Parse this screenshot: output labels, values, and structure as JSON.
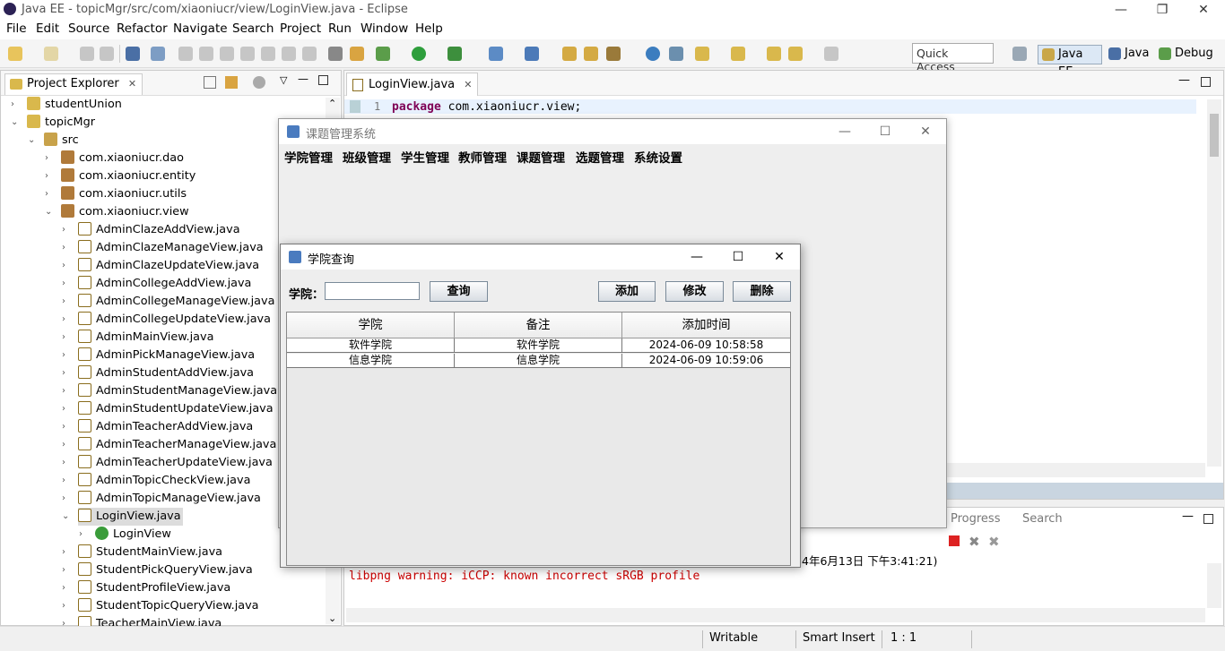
{
  "window": {
    "title": "Java EE - topicMgr/src/com/xiaoniucr/view/LoginView.java - Eclipse",
    "minimize": "—",
    "restore": "❐",
    "close": "✕"
  },
  "menu": [
    "File",
    "Edit",
    "Source",
    "Refactor",
    "Navigate",
    "Search",
    "Project",
    "Run",
    "Window",
    "Help"
  ],
  "toolbar": {
    "quick_access": "Quick Access",
    "perspectives": [
      "Java EE",
      "Java",
      "Debug"
    ]
  },
  "project_explorer": {
    "tab_label": "Project Explorer",
    "tab_close": "✕",
    "tree": [
      {
        "label": "studentUnion",
        "level": 1,
        "type": "proj",
        "arrow": "›"
      },
      {
        "label": "topicMgr",
        "level": 1,
        "type": "proj",
        "arrow": "⌄"
      },
      {
        "label": "src",
        "level": 2,
        "type": "src",
        "arrow": "⌄"
      },
      {
        "label": "com.xiaoniucr.dao",
        "level": 3,
        "type": "pkg",
        "arrow": "›"
      },
      {
        "label": "com.xiaoniucr.entity",
        "level": 3,
        "type": "pkg",
        "arrow": "›"
      },
      {
        "label": "com.xiaoniucr.utils",
        "level": 3,
        "type": "pkg",
        "arrow": "›"
      },
      {
        "label": "com.xiaoniucr.view",
        "level": 3,
        "type": "pkg",
        "arrow": "⌄"
      },
      {
        "label": "AdminClazeAddView.java",
        "level": 4,
        "type": "java",
        "arrow": "›"
      },
      {
        "label": "AdminClazeManageView.java",
        "level": 4,
        "type": "java",
        "arrow": "›"
      },
      {
        "label": "AdminClazeUpdateView.java",
        "level": 4,
        "type": "java",
        "arrow": "›"
      },
      {
        "label": "AdminCollegeAddView.java",
        "level": 4,
        "type": "java",
        "arrow": "›"
      },
      {
        "label": "AdminCollegeManageView.java",
        "level": 4,
        "type": "java",
        "arrow": "›"
      },
      {
        "label": "AdminCollegeUpdateView.java",
        "level": 4,
        "type": "java",
        "arrow": "›"
      },
      {
        "label": "AdminMainView.java",
        "level": 4,
        "type": "java",
        "arrow": "›"
      },
      {
        "label": "AdminPickManageView.java",
        "level": 4,
        "type": "java",
        "arrow": "›"
      },
      {
        "label": "AdminStudentAddView.java",
        "level": 4,
        "type": "java",
        "arrow": "›"
      },
      {
        "label": "AdminStudentManageView.java",
        "level": 4,
        "type": "java",
        "arrow": "›"
      },
      {
        "label": "AdminStudentUpdateView.java",
        "level": 4,
        "type": "java",
        "arrow": "›"
      },
      {
        "label": "AdminTeacherAddView.java",
        "level": 4,
        "type": "java",
        "arrow": "›"
      },
      {
        "label": "AdminTeacherManageView.java",
        "level": 4,
        "type": "java",
        "arrow": "›"
      },
      {
        "label": "AdminTeacherUpdateView.java",
        "level": 4,
        "type": "java",
        "arrow": "›"
      },
      {
        "label": "AdminTopicCheckView.java",
        "level": 4,
        "type": "java",
        "arrow": "›"
      },
      {
        "label": "AdminTopicManageView.java",
        "level": 4,
        "type": "java",
        "arrow": "›"
      },
      {
        "label": "LoginView.java",
        "level": 4,
        "type": "java",
        "arrow": "⌄",
        "selected": true
      },
      {
        "label": "LoginView",
        "level": 5,
        "type": "class",
        "arrow": "›"
      },
      {
        "label": "StudentMainView.java",
        "level": 4,
        "type": "java",
        "arrow": "›"
      },
      {
        "label": "StudentPickQueryView.java",
        "level": 4,
        "type": "java",
        "arrow": "›"
      },
      {
        "label": "StudentProfileView.java",
        "level": 4,
        "type": "java",
        "arrow": "›"
      },
      {
        "label": "StudentTopicQueryView.java",
        "level": 4,
        "type": "java",
        "arrow": "›"
      },
      {
        "label": "TeacherMainView.java",
        "level": 4,
        "type": "java",
        "arrow": "›"
      }
    ]
  },
  "editor": {
    "tab_label": "LoginView.java",
    "tab_close": "✕",
    "line_number": "1",
    "code_keyword": "package",
    "code_rest": " com.xiaoniucr.view;"
  },
  "console": {
    "tabs": [
      "Progress",
      "Search"
    ],
    "terminated_fragment": "4年6月13日 下午3:41:21)",
    "error_line": "libpng warning: iCCP: known incorrect sRGB profile"
  },
  "status": {
    "writable": "Writable",
    "insert_mode": "Smart Insert",
    "position": "1 : 1"
  },
  "app_window": {
    "title": "课题管理系统",
    "menus": [
      "学院管理",
      "班级管理",
      "学生管理",
      "教师管理",
      "课题管理",
      "选题管理",
      "系统设置"
    ]
  },
  "dialog": {
    "title": "学院查询",
    "search_label": "学院：",
    "search_value": "",
    "query_button": "查询",
    "add_button": "添加",
    "edit_button": "修改",
    "delete_button": "删除",
    "columns": [
      "学院",
      "备注",
      "添加时间"
    ],
    "rows": [
      [
        "软件学院",
        "软件学院",
        "2024-06-09 10:58:58"
      ],
      [
        "信息学院",
        "信息学院",
        "2024-06-09 10:59:06"
      ]
    ]
  }
}
